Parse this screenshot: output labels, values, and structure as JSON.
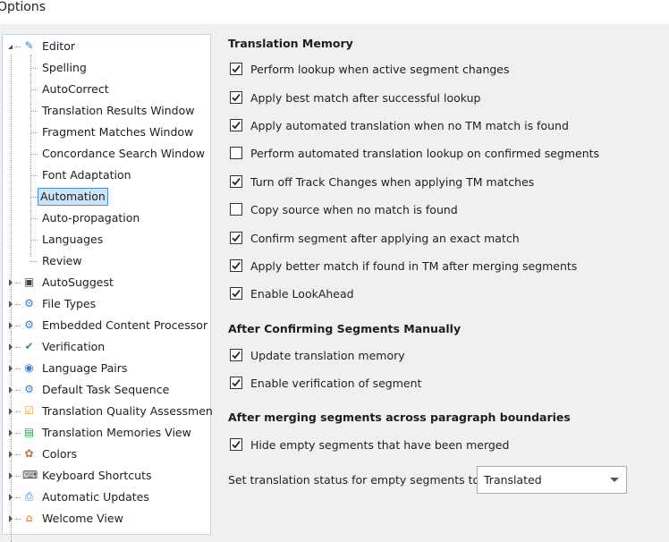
{
  "window": {
    "title": "Options"
  },
  "tree": {
    "root": {
      "label": "Editor",
      "icon": "pencil-icon",
      "expanded": true
    },
    "children": [
      {
        "label": "Spelling"
      },
      {
        "label": "AutoCorrect"
      },
      {
        "label": "Translation Results Window"
      },
      {
        "label": "Fragment Matches Window"
      },
      {
        "label": "Concordance Search Window"
      },
      {
        "label": "Font Adaptation"
      },
      {
        "label": "Automation",
        "selected": true
      },
      {
        "label": "Auto-propagation"
      },
      {
        "label": "Languages"
      },
      {
        "label": "Review"
      }
    ],
    "nodes": [
      {
        "label": "AutoSuggest",
        "icon": "autosuggest-icon"
      },
      {
        "label": "File Types",
        "icon": "file-gear-icon"
      },
      {
        "label": "Embedded Content Processor",
        "icon": "file-gear-icon"
      },
      {
        "label": "Verification",
        "icon": "verification-icon"
      },
      {
        "label": "Language Pairs",
        "icon": "language-pairs-icon"
      },
      {
        "label": "Default Task Sequence",
        "icon": "task-sequence-icon"
      },
      {
        "label": "Translation Quality Assessmen",
        "icon": "clipboard-check-icon"
      },
      {
        "label": "Translation Memories View",
        "icon": "translation-memories-icon"
      },
      {
        "label": "Colors",
        "icon": "palette-icon"
      },
      {
        "label": "Keyboard Shortcuts",
        "icon": "keyboard-icon"
      },
      {
        "label": "Automatic Updates",
        "icon": "computer-update-icon"
      },
      {
        "label": "Welcome View",
        "icon": "home-icon"
      }
    ]
  },
  "sections": [
    {
      "heading": "Translation Memory",
      "options": [
        {
          "label": "Perform lookup when active segment changes",
          "checked": true
        },
        {
          "label": "Apply best match after successful lookup",
          "checked": true
        },
        {
          "label": "Apply automated translation when no TM match is found",
          "checked": true
        },
        {
          "label": "Perform automated translation lookup on confirmed segments",
          "checked": false
        },
        {
          "label": "Turn off Track Changes when applying TM matches",
          "checked": true
        },
        {
          "label": "Copy source when no match is found",
          "checked": false
        },
        {
          "label": "Confirm segment after applying an exact match",
          "checked": true
        },
        {
          "label": "Apply better match if found in TM after merging segments",
          "checked": true
        },
        {
          "label": "Enable LookAhead",
          "checked": true
        }
      ]
    },
    {
      "heading": "After Confirming Segments Manually",
      "options": [
        {
          "label": "Update translation memory",
          "checked": true
        },
        {
          "label": "Enable verification of segment",
          "checked": true
        }
      ]
    },
    {
      "heading": "After merging segments across paragraph boundaries",
      "options": [
        {
          "label": "Hide empty segments that have been merged",
          "checked": true
        }
      ]
    }
  ],
  "status": {
    "label": "Set translation status for empty segments to:",
    "value": "Translated"
  }
}
